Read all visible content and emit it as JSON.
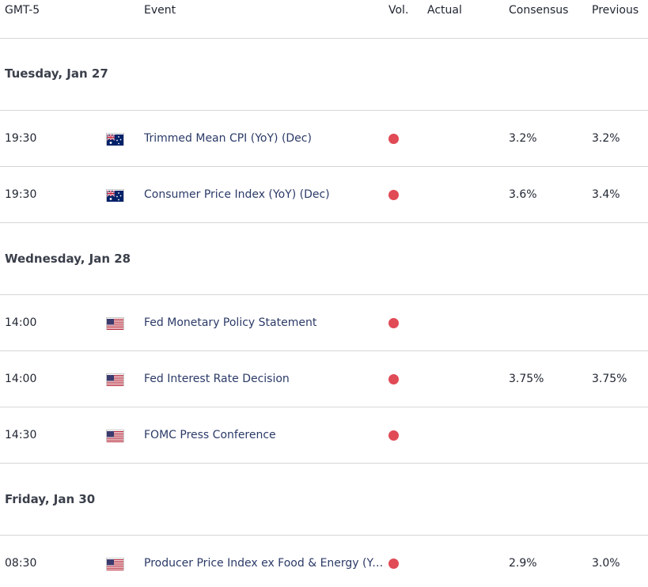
{
  "header": {
    "timezone": "GMT-5",
    "event": "Event",
    "vol": "Vol.",
    "actual": "Actual",
    "consensus": "Consensus",
    "previous": "Previous"
  },
  "colors": {
    "volatility_dot": "#e04b56",
    "event_text": "#2b3a67"
  },
  "days": [
    {
      "label": "Tuesday, Jan 27",
      "events": [
        {
          "time": "19:30",
          "flag": "australia-flag-icon",
          "event": "Trimmed Mean CPI (YoY) (Dec)",
          "volatility": "high",
          "actual": "",
          "consensus": "3.2%",
          "previous": "3.2%"
        },
        {
          "time": "19:30",
          "flag": "australia-flag-icon",
          "event": "Consumer Price Index (YoY) (Dec)",
          "volatility": "high",
          "actual": "",
          "consensus": "3.6%",
          "previous": "3.4%"
        }
      ]
    },
    {
      "label": "Wednesday, Jan 28",
      "events": [
        {
          "time": "14:00",
          "flag": "us-flag-icon",
          "event": "Fed Monetary Policy Statement",
          "volatility": "high",
          "actual": "",
          "consensus": "",
          "previous": ""
        },
        {
          "time": "14:00",
          "flag": "us-flag-icon",
          "event": "Fed Interest Rate Decision",
          "volatility": "high",
          "actual": "",
          "consensus": "3.75%",
          "previous": "3.75%"
        },
        {
          "time": "14:30",
          "flag": "us-flag-icon",
          "event": "FOMC Press Conference",
          "volatility": "high",
          "actual": "",
          "consensus": "",
          "previous": ""
        }
      ]
    },
    {
      "label": "Friday, Jan 30",
      "events": [
        {
          "time": "08:30",
          "flag": "us-flag-icon",
          "event": "Producer Price Index ex Food & Energy (YoY…",
          "volatility": "high",
          "actual": "",
          "consensus": "2.9%",
          "previous": "3.0%"
        }
      ]
    }
  ]
}
